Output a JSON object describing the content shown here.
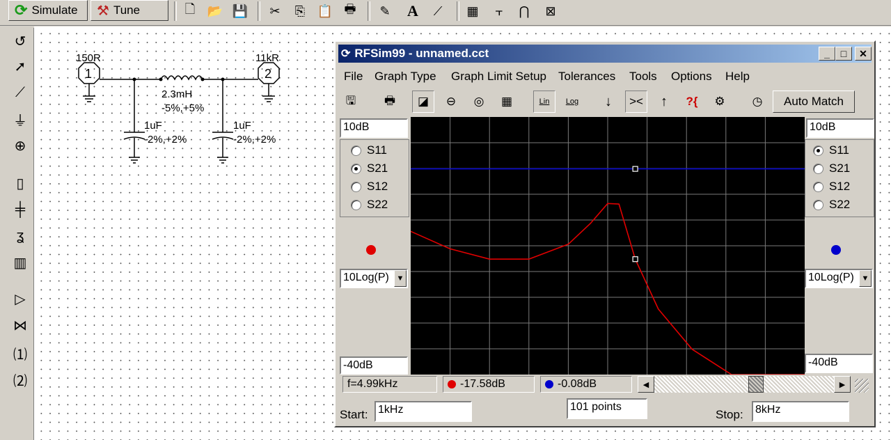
{
  "toolbar": {
    "simulate_label": "Simulate",
    "tune_label": "Tune"
  },
  "schematic": {
    "port1": {
      "impedance": "150R",
      "number": "1"
    },
    "port2": {
      "impedance": "11kR",
      "number": "2"
    },
    "inductor": {
      "value": "2.3mH",
      "tolerance": "-5%,+5%"
    },
    "capacitor1": {
      "value": "1uF",
      "tolerance": "-2%,+2%"
    },
    "capacitor2": {
      "value": "1uF",
      "tolerance": "-2%,+2%"
    }
  },
  "window": {
    "title": "RFSim99 - unnamed.cct",
    "menu": [
      "File",
      "Graph Type",
      "Graph Limit Setup",
      "Tolerances",
      "Tools",
      "Options",
      "Help"
    ],
    "toolbar": {
      "lin_label": "Lin",
      "log_label": "Log",
      "auto_match_label": "Auto Match"
    },
    "left_panel": {
      "top_value": "10dB",
      "bottom_value": "-40dB",
      "params": [
        "S11",
        "S21",
        "S12",
        "S22"
      ],
      "selected": "S21",
      "color": "#e00000",
      "scale_select": "10Log(P)"
    },
    "right_panel": {
      "top_value": "10dB",
      "bottom_value": "-40dB",
      "params": [
        "S11",
        "S21",
        "S12",
        "S22"
      ],
      "selected": "S11",
      "color": "#0000cc",
      "scale_select": "10Log(P)"
    },
    "status": {
      "frequency": "f=4.99kHz",
      "red_value": "-17.58dB",
      "blue_value": "-0.08dB"
    },
    "sweep": {
      "start_label": "Start:",
      "start_value": "1kHz",
      "points_value": "101 points",
      "stop_label": "Stop:",
      "stop_value": "8kHz"
    }
  },
  "chart_data": {
    "type": "line",
    "x_range": [
      "1kHz",
      "8kHz"
    ],
    "y_range_db": [
      -40,
      10
    ],
    "grid": true,
    "background": "#000000",
    "grid_divisions": {
      "x": 10,
      "y": 10
    },
    "marker_x": "4.99kHz",
    "series": [
      {
        "param": "S21",
        "color": "#e00000",
        "x_khz": [
          1.0,
          1.7,
          2.4,
          3.1,
          3.8,
          4.2,
          4.5,
          4.7,
          4.99,
          5.4,
          6.0,
          6.7,
          7.4,
          8.0
        ],
        "y_db": [
          -12.2,
          -15.6,
          -17.6,
          -17.6,
          -14.7,
          -10.6,
          -6.8,
          -6.9,
          -17.6,
          -27.3,
          -35.1,
          -40.0,
          -40.0,
          -40.0
        ]
      },
      {
        "param": "S11",
        "color": "#0000cc",
        "x_khz": [
          1.0,
          8.0
        ],
        "y_db": [
          -0.08,
          -0.08
        ]
      }
    ]
  }
}
